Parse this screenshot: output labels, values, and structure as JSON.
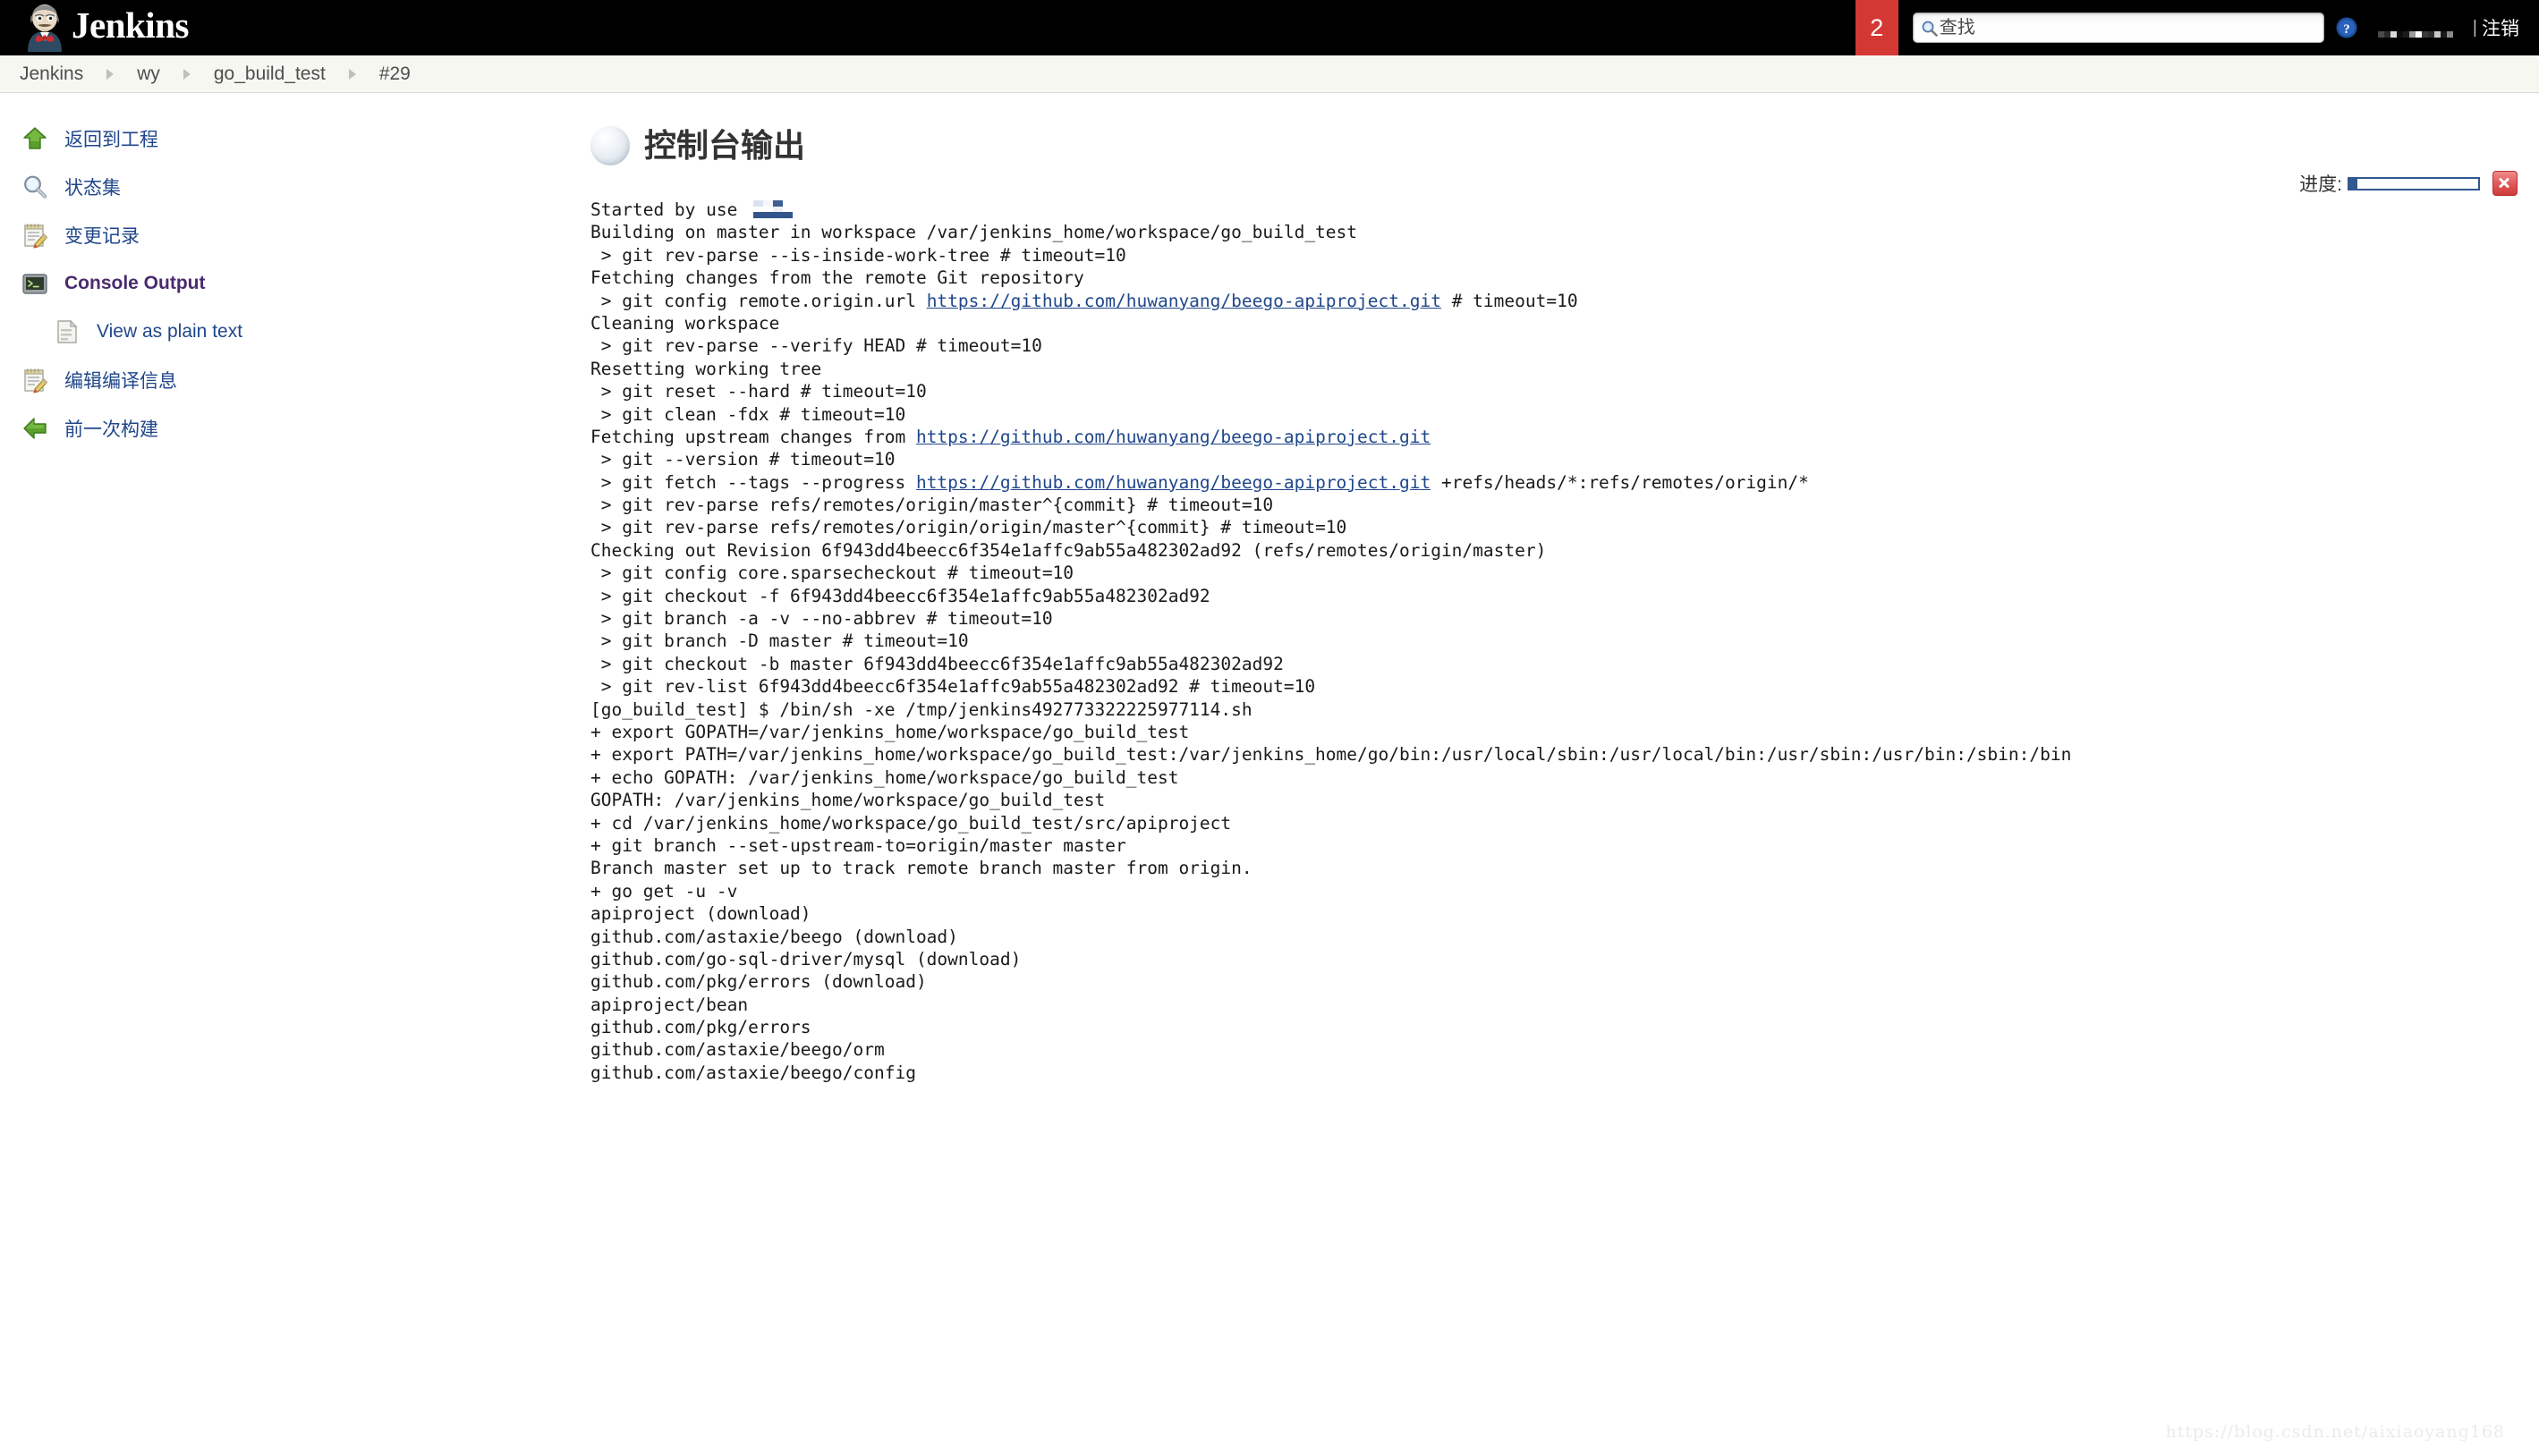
{
  "header": {
    "brand": "Jenkins",
    "logo_icon": "jenkins-butler-logo",
    "notification_count": "2",
    "search_placeholder": "查找",
    "search_value": "",
    "search_icon": "search-icon",
    "help_icon": "help-circle-icon",
    "user_name_redacted": "",
    "logout_separator": "|",
    "logout_label": "注销"
  },
  "breadcrumb": {
    "items": [
      {
        "label": "Jenkins"
      },
      {
        "label": "wy"
      },
      {
        "label": "go_build_test"
      },
      {
        "label": "#29"
      }
    ]
  },
  "sidebar": {
    "items": [
      {
        "label": "返回到工程",
        "icon": "up-arrow-icon",
        "active": false
      },
      {
        "label": "状态集",
        "icon": "magnifier-icon",
        "active": false
      },
      {
        "label": "变更记录",
        "icon": "notepad-pencil-icon",
        "active": false
      },
      {
        "label": "Console Output",
        "icon": "terminal-icon",
        "active": true
      },
      {
        "label": "View as plain text",
        "icon": "document-icon",
        "active": false
      },
      {
        "label": "编辑编译信息",
        "icon": "notepad-pencil-icon",
        "active": false
      },
      {
        "label": "前一次构建",
        "icon": "left-arrow-icon",
        "active": false
      }
    ]
  },
  "main": {
    "title": "控制台输出",
    "status_icon": "grey-ball-icon",
    "progress": {
      "label": "进度:",
      "percent": 6,
      "cancel_icon": "red-x-icon"
    }
  },
  "console": {
    "lines": [
      {
        "text": "Started by use ",
        "mosaic": true
      },
      {
        "text": "Building on master in workspace /var/jenkins_home/workspace/go_build_test"
      },
      {
        "text": " > git rev-parse --is-inside-work-tree # timeout=10"
      },
      {
        "text": "Fetching changes from the remote Git repository"
      },
      {
        "pre": " > git config remote.origin.url ",
        "link": "https://github.com/huwanyang/beego-apiproject.git",
        "post": " # timeout=10"
      },
      {
        "text": "Cleaning workspace"
      },
      {
        "text": " > git rev-parse --verify HEAD # timeout=10"
      },
      {
        "text": "Resetting working tree"
      },
      {
        "text": " > git reset --hard # timeout=10"
      },
      {
        "text": " > git clean -fdx # timeout=10"
      },
      {
        "pre": "Fetching upstream changes from ",
        "link": "https://github.com/huwanyang/beego-apiproject.git",
        "post": ""
      },
      {
        "text": " > git --version # timeout=10"
      },
      {
        "pre": " > git fetch --tags --progress ",
        "link": "https://github.com/huwanyang/beego-apiproject.git",
        "post": " +refs/heads/*:refs/remotes/origin/*"
      },
      {
        "text": " > git rev-parse refs/remotes/origin/master^{commit} # timeout=10"
      },
      {
        "text": " > git rev-parse refs/remotes/origin/origin/master^{commit} # timeout=10"
      },
      {
        "text": "Checking out Revision 6f943dd4beecc6f354e1affc9ab55a482302ad92 (refs/remotes/origin/master)"
      },
      {
        "text": " > git config core.sparsecheckout # timeout=10"
      },
      {
        "text": " > git checkout -f 6f943dd4beecc6f354e1affc9ab55a482302ad92"
      },
      {
        "text": " > git branch -a -v --no-abbrev # timeout=10"
      },
      {
        "text": " > git branch -D master # timeout=10"
      },
      {
        "text": " > git checkout -b master 6f943dd4beecc6f354e1affc9ab55a482302ad92"
      },
      {
        "text": " > git rev-list 6f943dd4beecc6f354e1affc9ab55a482302ad92 # timeout=10"
      },
      {
        "text": "[go_build_test] $ /bin/sh -xe /tmp/jenkins492773322225977114.sh"
      },
      {
        "text": "+ export GOPATH=/var/jenkins_home/workspace/go_build_test"
      },
      {
        "text": "+ export PATH=/var/jenkins_home/workspace/go_build_test:/var/jenkins_home/go/bin:/usr/local/sbin:/usr/local/bin:/usr/sbin:/usr/bin:/sbin:/bin"
      },
      {
        "text": "+ echo GOPATH: /var/jenkins_home/workspace/go_build_test"
      },
      {
        "text": "GOPATH: /var/jenkins_home/workspace/go_build_test"
      },
      {
        "text": "+ cd /var/jenkins_home/workspace/go_build_test/src/apiproject"
      },
      {
        "text": "+ git branch --set-upstream-to=origin/master master"
      },
      {
        "text": "Branch master set up to track remote branch master from origin."
      },
      {
        "text": "+ go get -u -v"
      },
      {
        "text": "apiproject (download)"
      },
      {
        "text": "github.com/astaxie/beego (download)"
      },
      {
        "text": "github.com/go-sql-driver/mysql (download)"
      },
      {
        "text": "github.com/pkg/errors (download)"
      },
      {
        "text": "apiproject/bean"
      },
      {
        "text": "github.com/pkg/errors"
      },
      {
        "text": "github.com/astaxie/beego/orm"
      },
      {
        "text": "github.com/astaxie/beego/config"
      }
    ]
  },
  "watermark": "https://blog.csdn.net/aixiaoyang168",
  "colors": {
    "topbar_bg": "#000000",
    "badge_red": "#d33833",
    "link_blue": "#20478b",
    "active_purple": "#4b2a6e",
    "progress_blue": "#31598f",
    "breadcrumb_bg": "#f7f7f2"
  }
}
